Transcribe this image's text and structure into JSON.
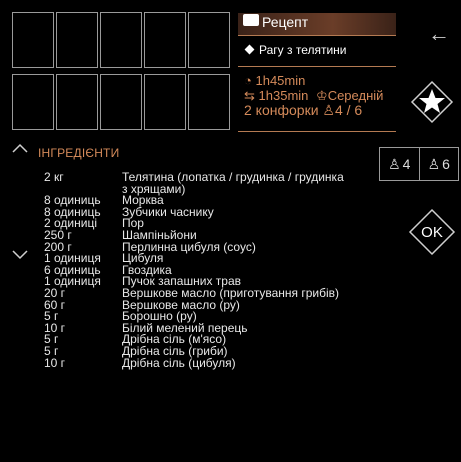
{
  "header": {
    "title": "Рецепт",
    "recipe_name": "Рагу з телятини",
    "total_time": "1h45min",
    "cook_time": "1h35min",
    "difficulty": "Середній",
    "burners": "2 конфорки",
    "servings": "4 / 6"
  },
  "icons": {
    "book": "book-icon",
    "back": "arrow-left-icon",
    "favorite": "star-icon",
    "clock": "clock-icon",
    "pot": "pot-icon",
    "chef": "chef-hat-icon",
    "person": "person-icon",
    "up": "chevron-up-icon",
    "down": "chevron-down-icon"
  },
  "ingredients": {
    "heading": "ІНГРЕДІЄНТИ",
    "items": [
      {
        "qty": "2 кг",
        "name": "Телятина (лопатка / грудинка / грудинка з хрящами)"
      },
      {
        "qty": "8 одиниць",
        "name": "Морква"
      },
      {
        "qty": "8 одиниць",
        "name": "Зубчики часнику"
      },
      {
        "qty": "2 одиниці",
        "name": "Пор"
      },
      {
        "qty": "250 г",
        "name": "Шампіньйони"
      },
      {
        "qty": "200 г",
        "name": "Перлинна цибуля (соус)"
      },
      {
        "qty": "1 одиниця",
        "name": "Цибуля"
      },
      {
        "qty": "6 одиниць",
        "name": "Гвоздика"
      },
      {
        "qty": "1 одиниця",
        "name": "Пучок запашних трав"
      },
      {
        "qty": "20 г",
        "name": "Вершкове масло (приготування грибів)"
      },
      {
        "qty": "60 г",
        "name": "Вершкове масло (ру)"
      },
      {
        "qty": "5 г",
        "name": "Борошно (ру)"
      },
      {
        "qty": "10 г",
        "name": "Білий мелений перець"
      },
      {
        "qty": "5 г",
        "name": "Дрібна сіль (м'ясо)"
      },
      {
        "qty": "5 г",
        "name": "Дрібна сіль (гриби)"
      },
      {
        "qty": "10 г",
        "name": "Дрібна сіль (цибуля)"
      }
    ]
  },
  "portions": {
    "option_a": "4",
    "option_b": "6"
  },
  "ok_label": "OK",
  "colors": {
    "accent": "#d48a5a",
    "header_bar": "#6a3d28",
    "border": "#9a9a9a"
  }
}
